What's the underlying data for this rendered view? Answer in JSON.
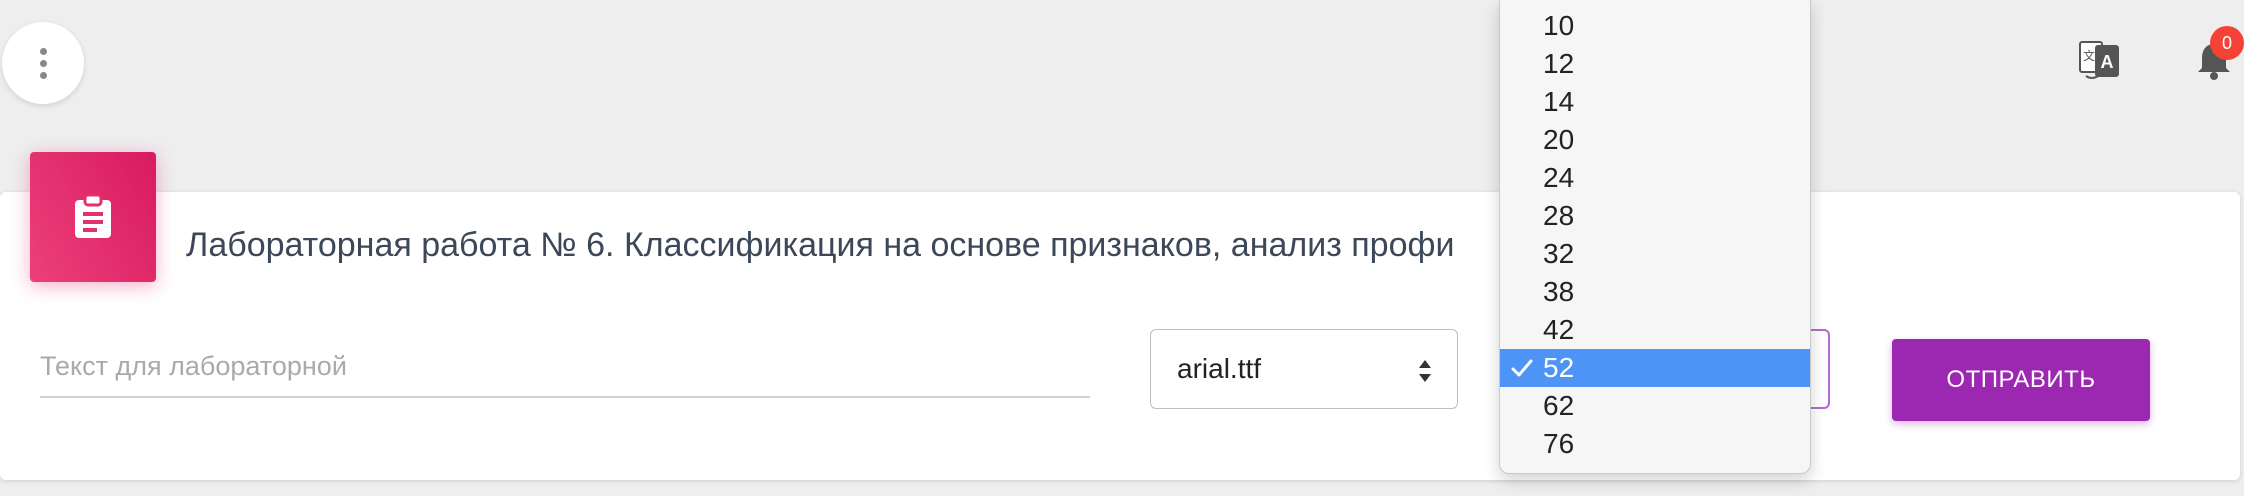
{
  "header": {
    "notifications_count": "0"
  },
  "card": {
    "title": "Лабораторная работа № 6. Классификация на основе признаков, анализ профи"
  },
  "form": {
    "text_placeholder": "Текст для лабораторной",
    "text_value": "",
    "font_selected": "arial.ttf",
    "submit_label": "ОТПРАВИТЬ"
  },
  "size_dropdown": {
    "options": [
      "10",
      "12",
      "14",
      "20",
      "24",
      "28",
      "32",
      "38",
      "42",
      "52",
      "62",
      "76"
    ],
    "selected": "52"
  },
  "colors": {
    "background": "#eeeeee",
    "card_icon": "#e91e63",
    "submit": "#9c27b0",
    "selected_option": "#4d94f6",
    "badge": "#f44336",
    "focus_border": "#b46ad0"
  },
  "icons": {
    "menu": "more-vert-icon",
    "translate": "translate-icon",
    "notifications": "bell-icon",
    "card": "clipboard-icon",
    "select_arrows": "updown-arrows-icon",
    "selected_mark": "check-icon"
  }
}
